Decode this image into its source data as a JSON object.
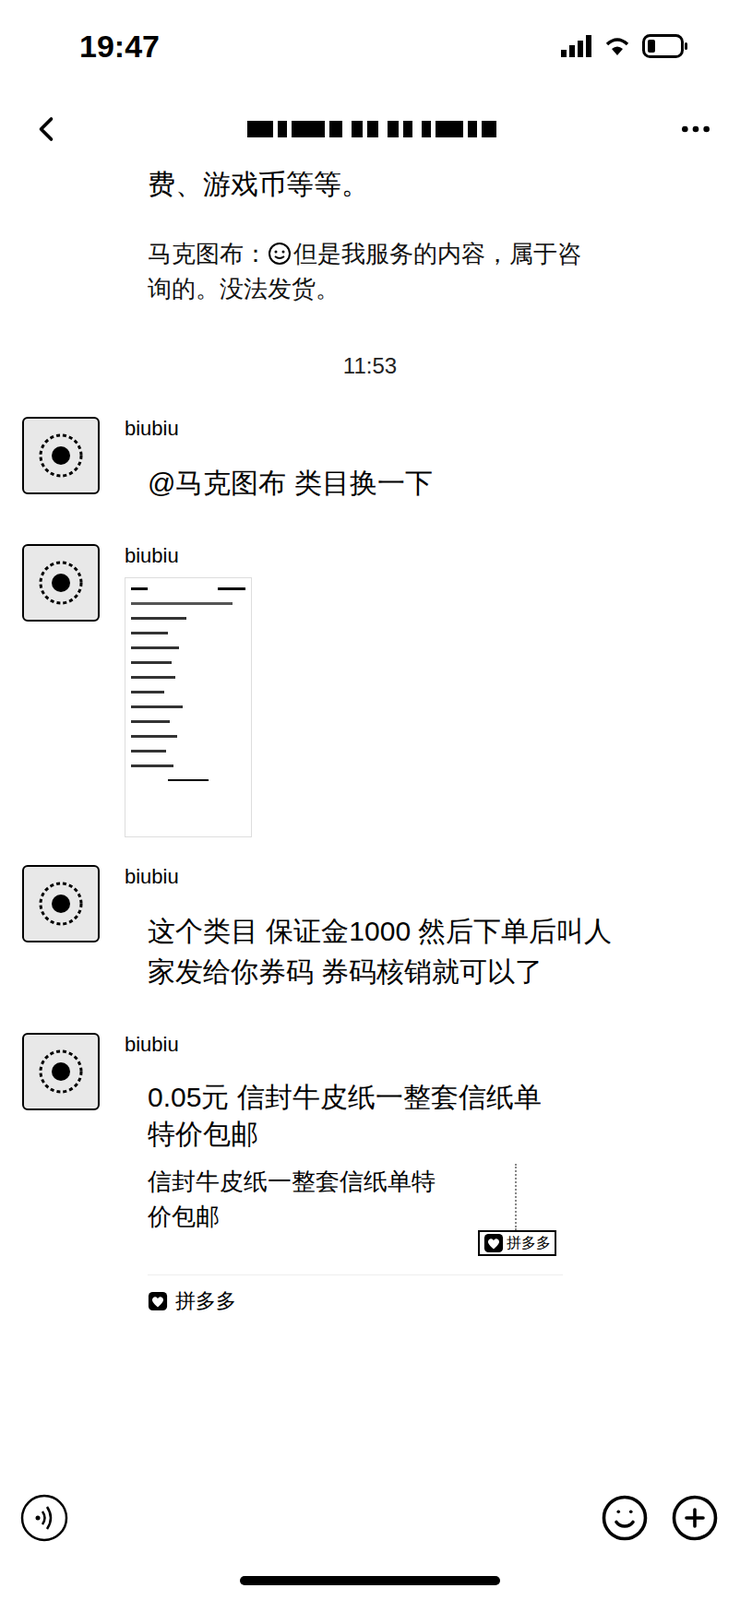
{
  "status_bar": {
    "time": "19:47"
  },
  "nav": {
    "title_obscured": true
  },
  "previous": {
    "text": "费、游戏币等等。",
    "quote": {
      "label": "马克图布：",
      "text": "但是我服务的内容，属于咨询的。没法发货。"
    }
  },
  "divider": {
    "time": "11:53"
  },
  "messages": [
    {
      "kind": "text",
      "sender": "biubiu",
      "text": "@马克图布 类目换一下"
    },
    {
      "kind": "image",
      "sender": "biubiu"
    },
    {
      "kind": "text",
      "sender": "biubiu",
      "text": "这个类目 保证金1000 然后下单后叫人家发给你券码 券码核销就可以了"
    },
    {
      "kind": "link",
      "sender": "biubiu",
      "title": "0.05元 信封牛皮纸一整套信纸单特价包邮",
      "description": "信封牛皮纸一整套信纸单特价包邮",
      "thumb_label": "拼多多",
      "source": "拼多多"
    }
  ]
}
